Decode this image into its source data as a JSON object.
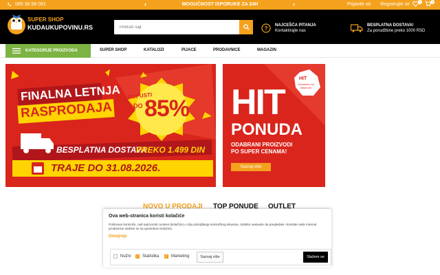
{
  "topbar": {
    "phone": "065 38 58 091",
    "promo": "MOGUĆNOST ISPORUKE ZA 24H",
    "prev": "‹",
    "next": "›",
    "login": "Prijavite se",
    "register": "Registrujte se",
    "wishlist_count": "0",
    "cart_count": "0"
  },
  "header": {
    "logo_line1": "SUPER SHOP",
    "logo_line2": "KUDAUKUPOVINU.RS",
    "search_placeholder": "Pretraži sajt",
    "faq_title": "NAJCEŠĆA PITANJA",
    "faq_sub": "Kontaktirajte nas",
    "delivery_title": "BESPLATNA DOSTAVA!",
    "delivery_sub": "Za porudžbine preko 1000 RSD"
  },
  "nav": {
    "categories": "KATEGORIJE PROIZVODA",
    "items": [
      "SUPER SHOP",
      "KATALOZI",
      "PIJACE",
      "PRODAVNICE",
      "MAGAZIN"
    ]
  },
  "banner_main": {
    "line1": "FINALNA LETNJA",
    "line2": "RASPRODAJA",
    "discount_top": "POPUSTI",
    "discount_do": "DO",
    "discount_value": "85%",
    "shipping_a": "BESPLATNA DOSTAVA",
    "shipping_b": "PREKO 1.499 DIN",
    "until": "TRAJE DO 31.08.2026."
  },
  "banner_side": {
    "badge_hit": "HIT",
    "badge_text": "Označeno sa stikerom!",
    "big1": "HIT",
    "big2": "PONUDA",
    "sub1": "ODABRANI PROIZVODI",
    "sub2": "PO SUPER CENAMA!",
    "button": "Saznaj više"
  },
  "tabs": [
    "NOVO U PRODAJI",
    "TOP PONUDE",
    "OUTLET"
  ],
  "cookie": {
    "title": "Ova web-stranica koristi kolačiće",
    "text": "Poštovani korisniče, naš sajt koristi cookies (kolačiće) u cilju poboljšanja korisničkog iskustva. Ukoliko nastavite da pregledate i koristite naše internet prodavnice slažete se sa upotrebom kolačića.",
    "details": "Detaljnije",
    "options": [
      {
        "label": "Nužni",
        "checked": false
      },
      {
        "label": "Statistika",
        "checked": true
      },
      {
        "label": "Marketing",
        "checked": true
      }
    ],
    "more": "Saznaj više",
    "accept": "Slažem se"
  },
  "colors": {
    "accent": "#f4a21e",
    "green": "#7cb342",
    "red": "#d9251c",
    "yellow": "#ffd400"
  }
}
